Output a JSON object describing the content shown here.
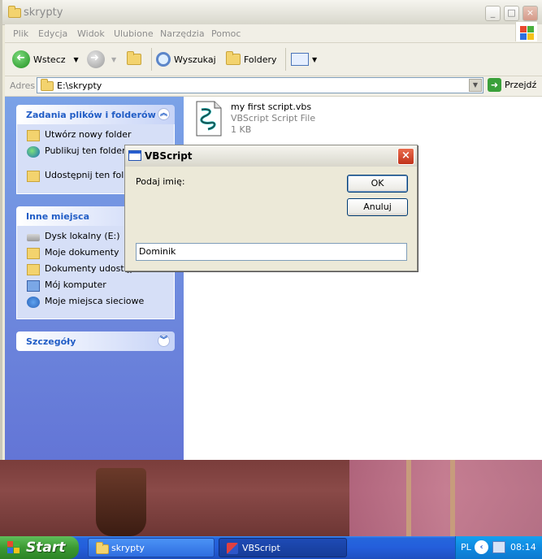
{
  "window": {
    "title": "skrypty",
    "controls": {
      "minimize": "_",
      "maximize": "□",
      "close": "×"
    }
  },
  "menu": [
    "Plik",
    "Edycja",
    "Widok",
    "Ulubione",
    "Narzędzia",
    "Pomoc"
  ],
  "toolbar": {
    "back": "Wstecz",
    "search": "Wyszukaj",
    "folders": "Foldery"
  },
  "address": {
    "label": "Adres",
    "value": "E:\\skrypty",
    "go": "Przejdź"
  },
  "sidebar": {
    "tasks": {
      "title": "Zadania plików i folderów",
      "items": [
        "Utwórz nowy folder",
        "Publikuj ten folder w Web",
        "Udostępnij ten folder"
      ]
    },
    "places": {
      "title": "Inne miejsca",
      "items": [
        "Dysk lokalny (E:)",
        "Moje dokumenty",
        "Dokumenty udostępnione",
        "Mój komputer",
        "Moje miejsca sieciowe"
      ]
    },
    "details": {
      "title": "Szczegóły"
    }
  },
  "file": {
    "name": "my first  script.vbs",
    "type": "VBScript Script File",
    "size": "1 KB"
  },
  "dialog": {
    "title": "VBScript",
    "close": "×",
    "prompt": "Podaj imię:",
    "ok": "OK",
    "cancel": "Anuluj",
    "input_value": "Dominik"
  },
  "taskbar": {
    "start": "Start",
    "tasks": [
      "skrypty",
      "VBScript"
    ],
    "language": "PL",
    "clock": "08:14"
  },
  "colors": {
    "taskbar": "#245edb",
    "start": "#3c9a33",
    "sidebar": "#7ba2e7",
    "dialog_close": "#c1321a"
  }
}
